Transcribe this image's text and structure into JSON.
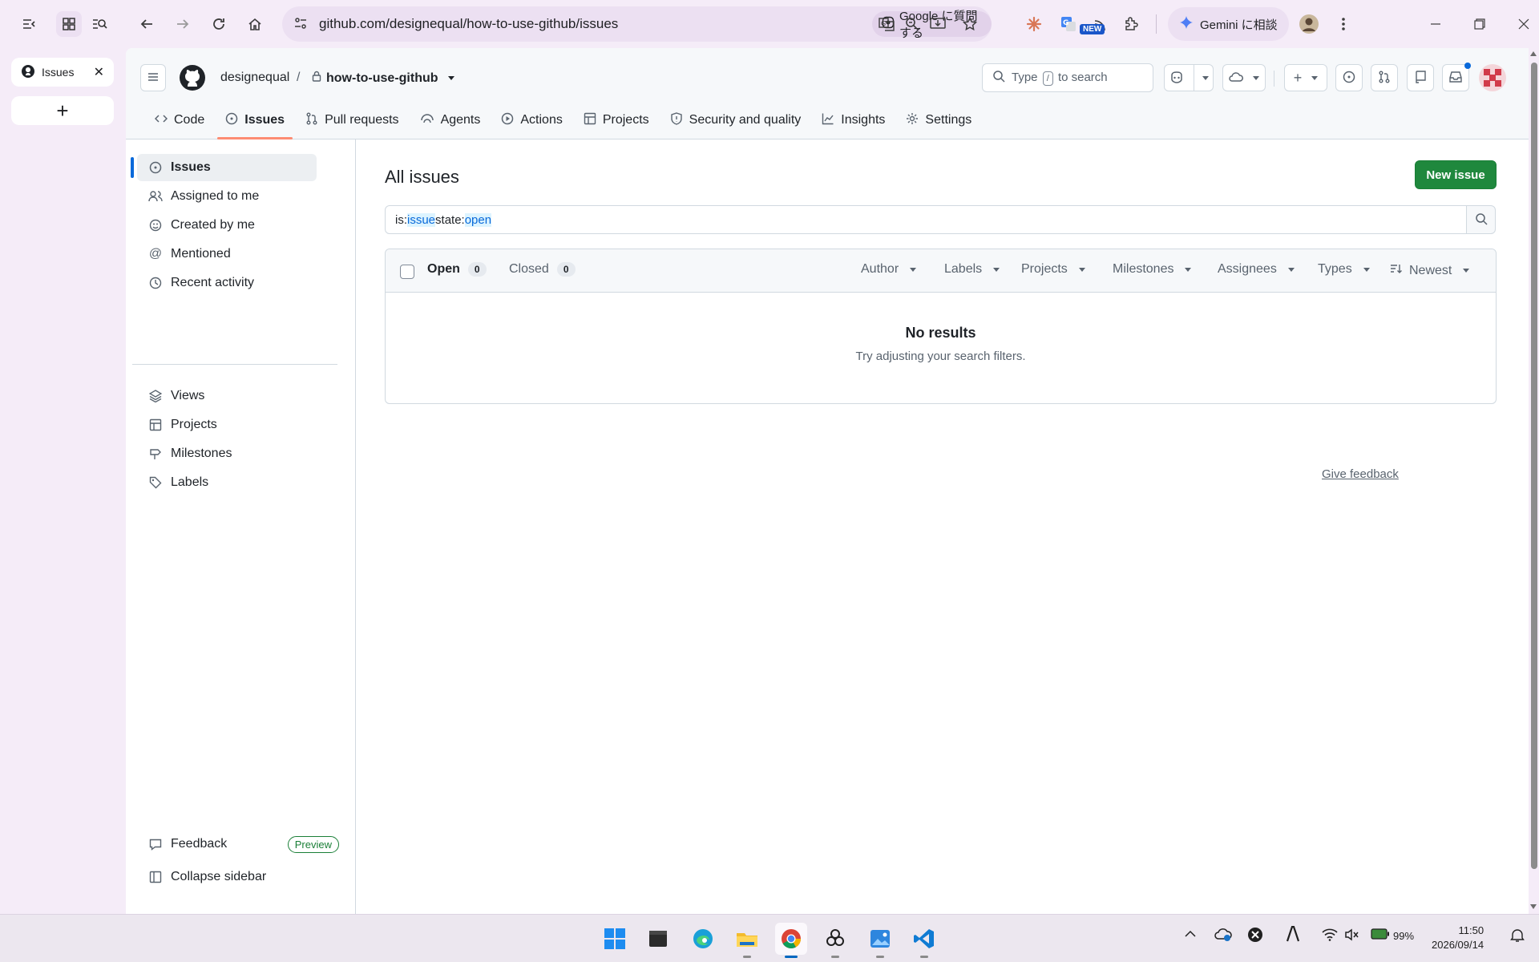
{
  "browser": {
    "tab_title": "Issues",
    "url": "github.com/designequal/how-to-use-github/issues",
    "lens_label": "Google に質問する",
    "gemini_label": "Gemini に相談",
    "new_badge": "NEW"
  },
  "repo": {
    "owner": "designequal",
    "separator": "/",
    "name": "how-to-use-github",
    "search_prefix": "Type",
    "search_key": "/",
    "search_suffix": "to search"
  },
  "repo_nav": [
    {
      "label": "Code",
      "icon": "code-icon"
    },
    {
      "label": "Issues",
      "icon": "issue-opened-icon",
      "active": true
    },
    {
      "label": "Pull requests",
      "icon": "pull-request-icon"
    },
    {
      "label": "Agents",
      "icon": "agents-icon"
    },
    {
      "label": "Actions",
      "icon": "play-icon"
    },
    {
      "label": "Projects",
      "icon": "table-icon"
    },
    {
      "label": "Security and quality",
      "icon": "shield-icon"
    },
    {
      "label": "Insights",
      "icon": "graph-icon"
    },
    {
      "label": "Settings",
      "icon": "gear-icon"
    }
  ],
  "sidebar": {
    "items": [
      {
        "label": "Issues",
        "icon": "issue-opened-icon",
        "active": true
      },
      {
        "label": "Assigned to me",
        "icon": "people-icon"
      },
      {
        "label": "Created by me",
        "icon": "smiley-icon"
      },
      {
        "label": "Mentioned",
        "icon": "mention-icon"
      },
      {
        "label": "Recent activity",
        "icon": "clock-icon"
      },
      {
        "label": "Views",
        "icon": "stack-icon"
      },
      {
        "label": "Projects",
        "icon": "table-icon"
      },
      {
        "label": "Milestones",
        "icon": "milestone-icon"
      },
      {
        "label": "Labels",
        "icon": "tag-icon"
      }
    ],
    "feedback_label": "Feedback",
    "preview_badge": "Preview",
    "collapse_label": "Collapse sidebar"
  },
  "main": {
    "title": "All issues",
    "new_issue_label": "New issue",
    "query": {
      "p1": "is:",
      "p2": "issue",
      "p3": " state:",
      "p4": "open"
    },
    "open_label": "Open",
    "open_count": "0",
    "closed_label": "Closed",
    "closed_count": "0",
    "filters": [
      "Author",
      "Labels",
      "Projects",
      "Milestones",
      "Assignees",
      "Types",
      "Newest"
    ],
    "no_results_title": "No results",
    "no_results_hint": "Try adjusting your search filters.",
    "give_feedback": "Give feedback"
  },
  "taskbar": {
    "battery": "99%",
    "time": "11:50",
    "date": "2026/09/14"
  },
  "colors": {
    "primary_button": "#1f883d",
    "accent_link": "#0969da",
    "active_tab_underline": "#fd8c73",
    "browser_frame": "#f5ecf8"
  }
}
